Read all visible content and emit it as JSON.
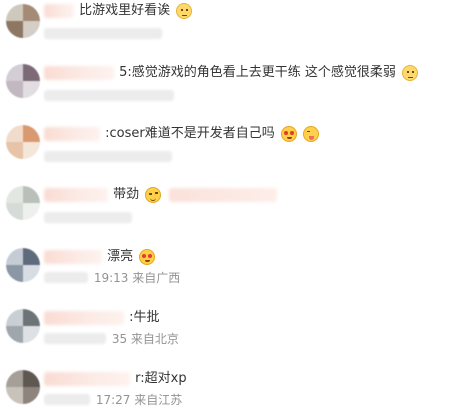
{
  "comments": [
    {
      "text": "比游戏里好看诶",
      "emoji": "cat-face-emoji",
      "meta": ""
    },
    {
      "text": "5:感觉游戏的角色看上去更干练 这个感觉很柔弱",
      "emoji": "cat-face-emoji",
      "meta": ""
    },
    {
      "text": ":coser难道不是开发者自己吗",
      "emoji": "heart-eyes-emoji",
      "emoji2": "tongue-emoji",
      "meta": ""
    },
    {
      "text": "带劲",
      "emoji": "wink-emoji",
      "meta": ""
    },
    {
      "text": "漂亮",
      "emoji": "heart-eyes-emoji",
      "meta": "19:13 来自广西"
    },
    {
      "text": ":牛批",
      "meta": "35 来自北京"
    },
    {
      "text": "r:超对xp",
      "meta": "17:27 来自江苏"
    }
  ],
  "colors": {
    "text": "#333333",
    "meta": "#939393",
    "blur_name": "#f9dcd3",
    "blur_meta": "#ececec"
  }
}
